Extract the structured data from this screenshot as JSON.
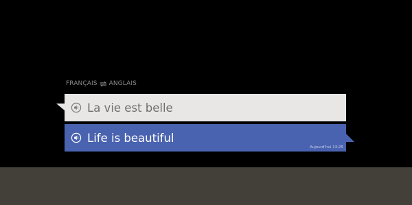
{
  "header": {
    "source_language": "FRANÇAIS",
    "swap_icon": "swap-arrows-icon",
    "target_language": "ANGLAIS"
  },
  "translation": {
    "source_text": "La vie est belle",
    "target_text": "Life is beautiful",
    "timestamp": "Aujourd'hui 13:25"
  },
  "icons": {
    "play_audio": "speaker-icon"
  },
  "colors": {
    "background": "#000000",
    "bottom_bar": "#433f39",
    "source_bubble": "#e9e7e5",
    "target_bubble": "#4a63b0"
  }
}
